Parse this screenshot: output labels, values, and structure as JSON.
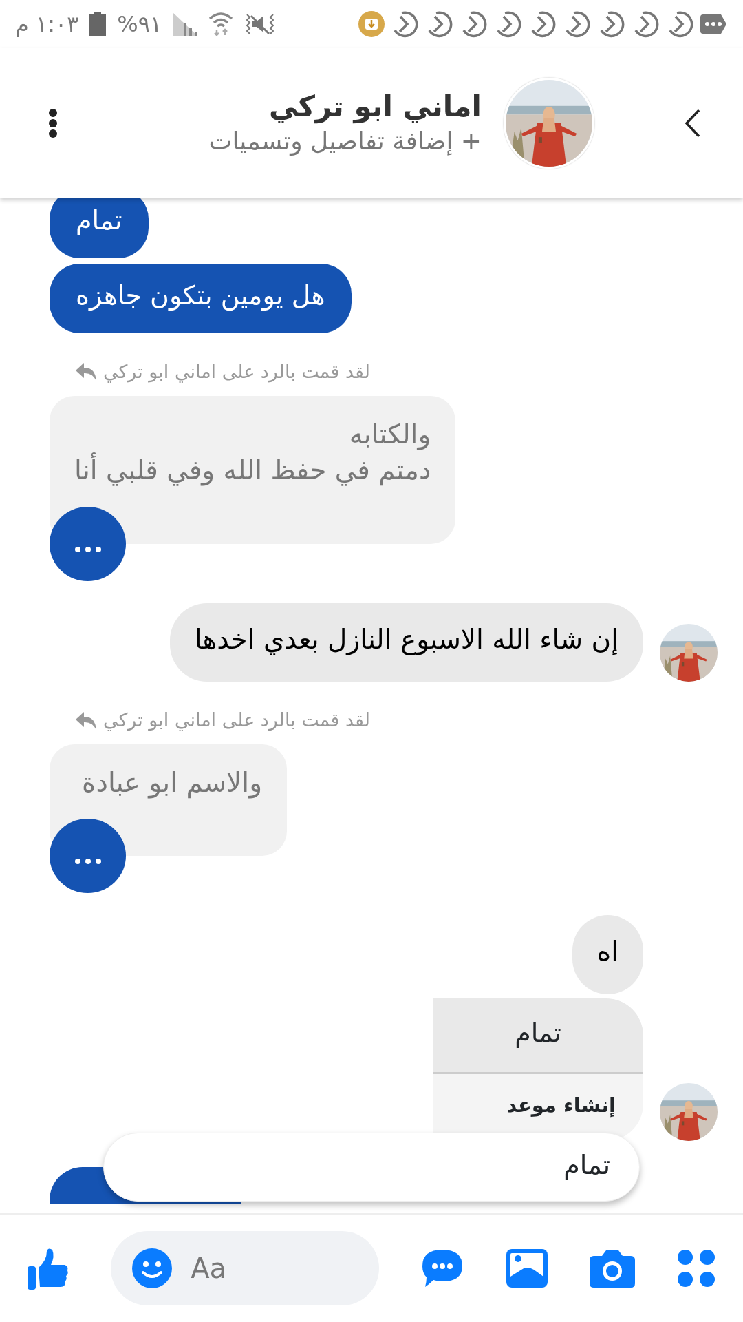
{
  "status_bar": {
    "time": "١:٠٣ م",
    "battery": "%٩١"
  },
  "header": {
    "title": "اماني ابو تركي",
    "subtitle": "+ إضافة تفاصيل وتسميات"
  },
  "messages": [
    {
      "kind": "sent",
      "text": "تمام"
    },
    {
      "kind": "sent",
      "text": "هل يومين بتكون جاهزه"
    },
    {
      "kind": "reply",
      "caption": "لقد قمت بالرد على اماني ابو تركي",
      "text": "والكتابه\nدمتم في حفظ الله وفي قلبي أنا"
    },
    {
      "kind": "received",
      "text": "إن شاء الله الاسبوع النازل بعدي اخدها",
      "avatar": true
    },
    {
      "kind": "reply",
      "caption": "لقد قمت بالرد على اماني ابو تركي",
      "text": "والاسم ابو عبادة"
    },
    {
      "kind": "received",
      "text": "اه",
      "avatar": false
    }
  ],
  "context_menu": {
    "avatar": true,
    "items": [
      {
        "kind": "message",
        "label": "تمام"
      },
      {
        "kind": "action",
        "label": "إنشاء موعد"
      }
    ]
  },
  "reply_popup": {
    "text": "تمام"
  },
  "composer": {
    "placeholder": "Aa"
  }
}
